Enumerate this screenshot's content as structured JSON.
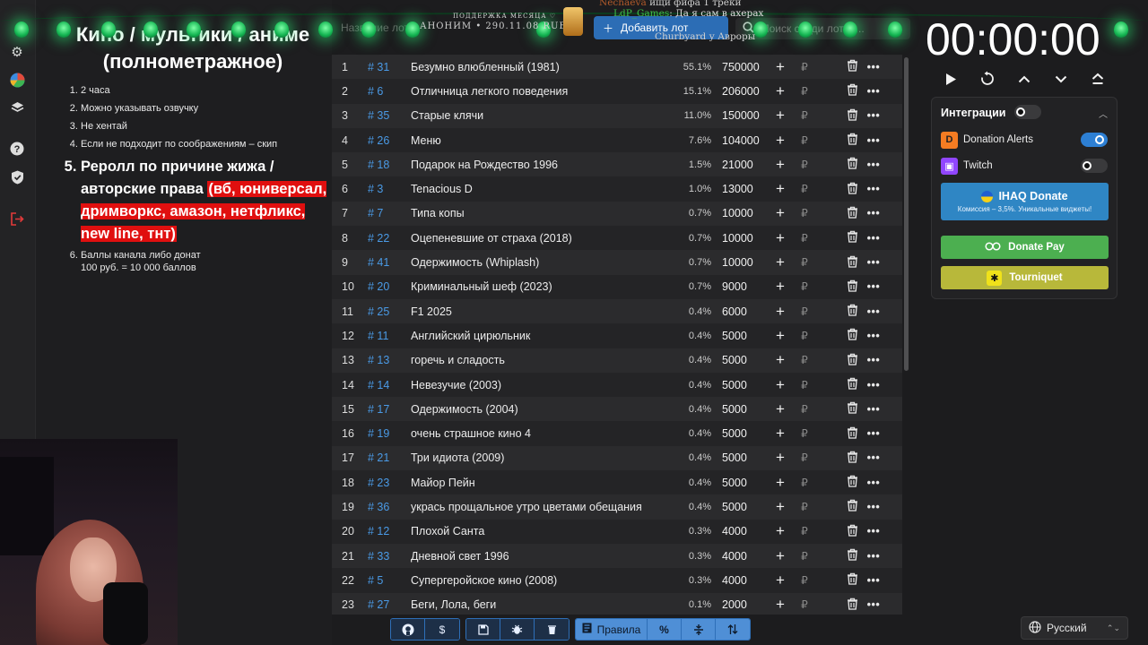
{
  "overlay": {
    "support_title": "ПОДДЕРЖКА МЕСЯЦА ♡",
    "support_line": "АНОНИМ • 290.11.08 RUB",
    "chat": [
      {
        "user": "Nechaeva",
        "text": "ищи фифа 1 треки",
        "user_color": "#b35a2a"
      },
      {
        "user": "LdP_Games",
        "text": ": Да я сам в ахерах",
        "user_color": "#3fbf4a"
      },
      {
        "user": "",
        "text": "Churbyard у Авроры",
        "user_color": "#cfcfcf"
      }
    ]
  },
  "toolbar": {
    "search_placeholder": "Название лота",
    "add_label": "Добавить лот",
    "lots_search_placeholder": "Поиск среди лотов..."
  },
  "rules": {
    "title": "Кино / мультики / аниме (полнометражное)",
    "items": [
      {
        "text": "2 часа"
      },
      {
        "text": "Можно указывать озвучку"
      },
      {
        "text": "Не хентай"
      },
      {
        "text": "Если не подходит по соображениям – скип"
      },
      {
        "text": "Реролл по причине жижа / авторские права ",
        "highlight": "(вб, юниверсал, дримворкс, амазон, нетфликс, new line, тнт)"
      },
      {
        "text": "Баллы канала либо донат",
        "text2": "100 руб. = 10 000 баллов"
      }
    ]
  },
  "lots": [
    {
      "n": "1",
      "id": "# 31",
      "name": "Безумно влюбленный (1981)",
      "pct": "55.1%",
      "amount": "750000"
    },
    {
      "n": "2",
      "id": "# 6",
      "name": "Отличница легкого поведения",
      "pct": "15.1%",
      "amount": "206000"
    },
    {
      "n": "3",
      "id": "# 35",
      "name": "Старые клячи",
      "pct": "11.0%",
      "amount": "150000"
    },
    {
      "n": "4",
      "id": "# 26",
      "name": "Меню",
      "pct": "7.6%",
      "amount": "104000"
    },
    {
      "n": "5",
      "id": "# 18",
      "name": "Подарок на Рождество 1996",
      "pct": "1.5%",
      "amount": "21000"
    },
    {
      "n": "6",
      "id": "# 3",
      "name": "Tenacious D",
      "pct": "1.0%",
      "amount": "13000"
    },
    {
      "n": "7",
      "id": "# 7",
      "name": "Типа копы",
      "pct": "0.7%",
      "amount": "10000"
    },
    {
      "n": "8",
      "id": "# 22",
      "name": "Оцепеневшие от страха (2018)",
      "pct": "0.7%",
      "amount": "10000"
    },
    {
      "n": "9",
      "id": "# 41",
      "name": "Одержимость (Whiplash)",
      "pct": "0.7%",
      "amount": "10000"
    },
    {
      "n": "10",
      "id": "# 20",
      "name": "Криминальный шеф (2023)",
      "pct": "0.7%",
      "amount": "9000"
    },
    {
      "n": "11",
      "id": "# 25",
      "name": "F1 2025",
      "pct": "0.4%",
      "amount": "6000"
    },
    {
      "n": "12",
      "id": "# 11",
      "name": "Английский цирюльник",
      "pct": "0.4%",
      "amount": "5000"
    },
    {
      "n": "13",
      "id": "# 13",
      "name": "горечь и сладость",
      "pct": "0.4%",
      "amount": "5000"
    },
    {
      "n": "14",
      "id": "# 14",
      "name": "Невезучие  (2003)",
      "pct": "0.4%",
      "amount": "5000"
    },
    {
      "n": "15",
      "id": "# 17",
      "name": "Одержимость (2004)",
      "pct": "0.4%",
      "amount": "5000"
    },
    {
      "n": "16",
      "id": "# 19",
      "name": "очень страшное кино 4",
      "pct": "0.4%",
      "amount": "5000"
    },
    {
      "n": "17",
      "id": "# 21",
      "name": "Три идиота (2009)",
      "pct": "0.4%",
      "amount": "5000"
    },
    {
      "n": "18",
      "id": "# 23",
      "name": "Майор Пейн",
      "pct": "0.4%",
      "amount": "5000"
    },
    {
      "n": "19",
      "id": "# 36",
      "name": "укрась прощальное утро цветами обещания",
      "pct": "0.4%",
      "amount": "5000"
    },
    {
      "n": "20",
      "id": "# 12",
      "name": "Плохой Санта",
      "pct": "0.3%",
      "amount": "4000"
    },
    {
      "n": "21",
      "id": "# 33",
      "name": "Дневной свет 1996",
      "pct": "0.3%",
      "amount": "4000"
    },
    {
      "n": "22",
      "id": "# 5",
      "name": "Супергеройское кино (2008)",
      "pct": "0.3%",
      "amount": "4000"
    },
    {
      "n": "23",
      "id": "# 27",
      "name": "Беги, Лола, беги",
      "pct": "0.1%",
      "amount": "2000"
    }
  ],
  "lot_icons": {
    "plus": "+",
    "currency": "₽",
    "trash": "trash-icon",
    "more": "•••"
  },
  "timer": {
    "value": "00:00:00"
  },
  "integrations": {
    "title": "Интеграции",
    "services": [
      {
        "name": "Donation Alerts",
        "enabled": true,
        "color": "#f57c22"
      },
      {
        "name": "Twitch",
        "enabled": false,
        "color": "#9146ff"
      }
    ],
    "ihaq": {
      "title": "IHAQ Donate",
      "subtitle": "Комиссия – 3,5%. Уникальные виджеты!",
      "color": "#2f86c4"
    },
    "donatepay": {
      "label": "Donate Pay",
      "color": "#4caf50"
    },
    "tourniquet": {
      "label": "Tourniquet",
      "color": "#b8b83a"
    }
  },
  "bottom": {
    "rules_label": "Правила",
    "percent_label": "%"
  },
  "language": {
    "selected": "Русский"
  }
}
